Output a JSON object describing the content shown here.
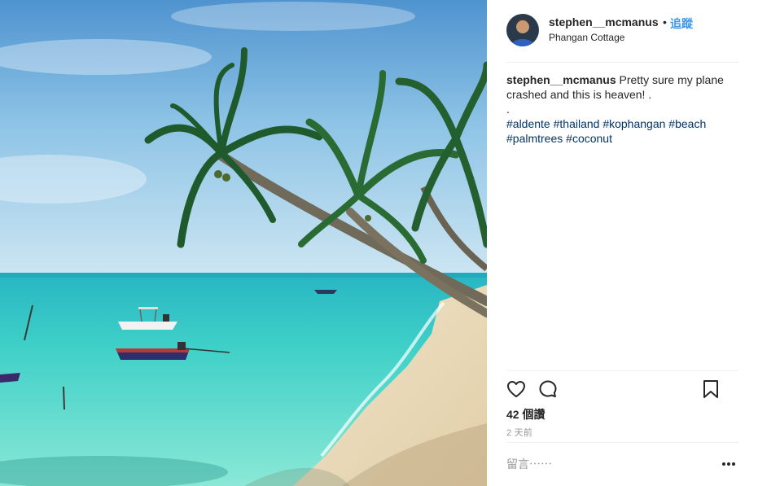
{
  "post": {
    "user": {
      "username": "stephen__mcmanus",
      "separator": "•",
      "follow_label": "追蹤",
      "location": "Phangan Cottage",
      "avatar_icon": "profile-avatar"
    },
    "caption": {
      "username": "stephen__mcmanus",
      "text": "Pretty sure my plane crashed and this is heaven! .",
      "dot_line": ".",
      "hashtags": [
        "#aldente",
        "#thailand",
        "#kophangan",
        "#beach",
        "#palmtrees",
        "#coconut"
      ]
    },
    "actions": {
      "like_icon": "heart-icon",
      "comment_icon": "comment-icon",
      "save_icon": "bookmark-icon"
    },
    "likes_text": "42 個讚",
    "time_text": "2 天前",
    "comment": {
      "placeholder": "留言⋯⋯",
      "more_icon": "more-options-icon"
    },
    "colors": {
      "link_blue": "#3897f0",
      "hashtag_blue": "#003569",
      "muted_gray": "#999999",
      "divider": "#efefef"
    }
  }
}
